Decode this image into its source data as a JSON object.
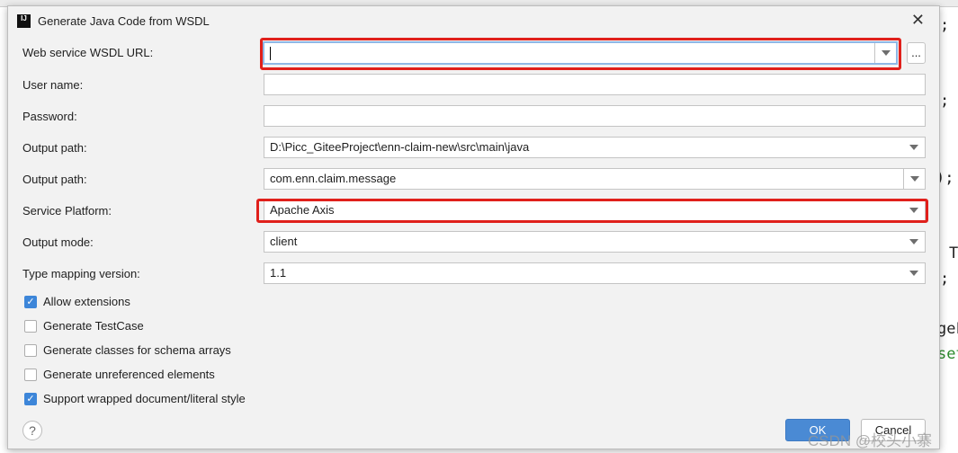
{
  "dialog": {
    "title": "Generate Java Code from WSDL",
    "logo": "IJ",
    "fields": [
      {
        "label": "Web service WSDL URL:",
        "value": "",
        "type": "combo"
      },
      {
        "label": "User name:",
        "value": "",
        "type": "text"
      },
      {
        "label": "Password:",
        "value": "",
        "type": "text"
      },
      {
        "label": "Output path:",
        "value": "D:\\Picc_GiteeProject\\enn-claim-new\\src\\main\\java",
        "type": "combo"
      },
      {
        "label": "Output path:",
        "value": "com.enn.claim.message",
        "type": "combo"
      },
      {
        "label": "Service Platform:",
        "value": "Apache Axis",
        "type": "combo"
      },
      {
        "label": "Output mode:",
        "value": "client",
        "type": "combo"
      },
      {
        "label": "Type mapping version:",
        "value": "1.1",
        "type": "combo"
      }
    ],
    "browse_label": "...",
    "checkboxes": [
      {
        "label": "Allow extensions",
        "checked": true
      },
      {
        "label": "Generate TestCase",
        "checked": false
      },
      {
        "label": "Generate classes for schema arrays",
        "checked": false
      },
      {
        "label": "Generate unreferenced elements",
        "checked": false
      },
      {
        "label": "Support wrapped document/literal style",
        "checked": true
      }
    ],
    "help": "?",
    "ok": "OK",
    "cancel": "Cancel",
    "highlight_color": "#e0201b"
  },
  "background_code": [
    ";",
    ";",
    ");",
    "T",
    ";",
    "geF",
    "set"
  ],
  "watermark": "CSDN @校头小寨"
}
